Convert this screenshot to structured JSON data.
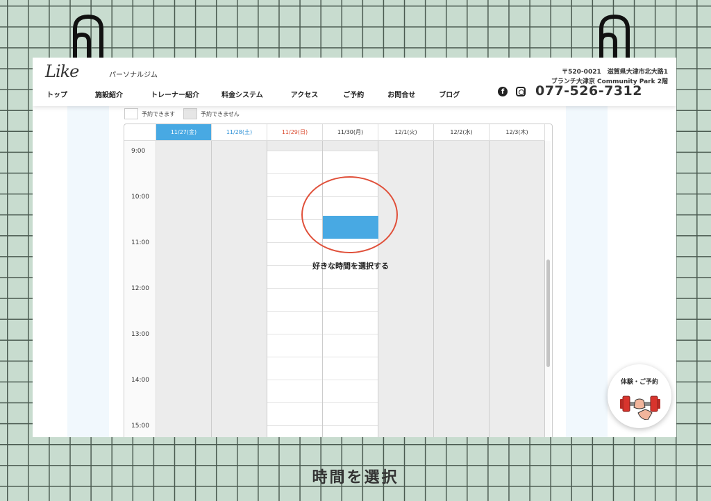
{
  "header": {
    "logo": "Like",
    "logo_sub": "パーソナルジム",
    "nav": [
      "トップ",
      "施設紹介",
      "トレーナー紹介",
      "料金システム",
      "アクセス",
      "ご予約",
      "お問合せ",
      "ブログ"
    ],
    "address_line1": "〒520-0021　滋賀県大津市北大路1",
    "address_line2": "ブランチ大津京 Community Park 2階",
    "phone": "077-526-7312"
  },
  "legend": {
    "available": "予約できます",
    "unavailable": "予約できません"
  },
  "calendar": {
    "days": [
      "11/27(金)",
      "11/28(土)",
      "11/29(日)",
      "11/30(月)",
      "12/1(火)",
      "12/2(水)",
      "12/3(木)"
    ],
    "times": [
      "9:00",
      "10:00",
      "11:00",
      "12:00",
      "13:00",
      "14:00",
      "15:00"
    ]
  },
  "annotation": "好きな時間を選択する",
  "badge": {
    "label": "体験・ご予約"
  },
  "caption": "時間を選択",
  "colors": {
    "accent": "#48a9e3",
    "annotation_red": "#e0503a",
    "background_green": "#c8dccf"
  }
}
